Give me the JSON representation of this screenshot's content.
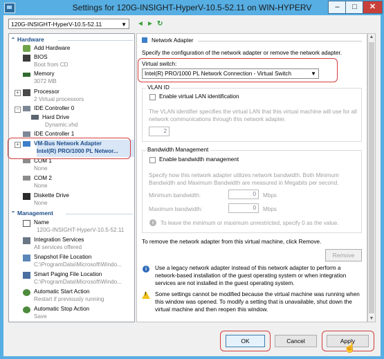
{
  "window": {
    "title": "Settings for 120G-INSIGHT-HyperV-10.5-52.11 on WIN-HYPERV",
    "minimize_glyph": "–",
    "maximize_glyph": "□",
    "close_glyph": "✕"
  },
  "toolbar": {
    "vm_selector_value": "120G-INSIGHT-HyperV-10.5-52.11",
    "back_glyph": "◄",
    "forward_glyph": "►",
    "refresh_glyph": "↻"
  },
  "tree": {
    "hardware_label": "Hardware",
    "management_label": "Management",
    "items": {
      "add_hardware": "Add Hardware",
      "bios": "BIOS",
      "bios_sub": "Boot from CD",
      "memory": "Memory",
      "memory_sub": "3072 MB",
      "processor": "Processor",
      "processor_sub": "2 Virtual processors",
      "ide0": "IDE Controller 0",
      "hard_drive": "Hard Drive",
      "hard_drive_sub": "Dynamic.vhd",
      "ide1": "IDE Controller 1",
      "vmbus": "VM-Bus Network Adapter",
      "vmbus_sub": "Intel(R) PRO/1000 PL Networ...",
      "com1": "COM 1",
      "com1_sub": "None",
      "com2": "COM 2",
      "com2_sub": "None",
      "diskette": "Diskette Drive",
      "diskette_sub": "None",
      "name": "Name",
      "name_sub": "120G-INSIGHT-HyperV-10.5-52.11",
      "integration": "Integration Services",
      "integration_sub": "All services offered",
      "snapshot": "Snapshot File Location",
      "snapshot_sub": "C:\\ProgramData\\Microsoft\\Windo...",
      "paging": "Smart Paging File Location",
      "paging_sub": "C:\\ProgramData\\Microsoft\\Windo...",
      "auto_start": "Automatic Start Action",
      "auto_start_sub": "Restart if previously running",
      "auto_stop": "Automatic Stop Action",
      "auto_stop_sub": "Save"
    }
  },
  "panel": {
    "header": "Network Adapter",
    "description": "Specify the configuration of the network adapter or remove the network adapter.",
    "virtual_switch_label": "Virtual switch:",
    "virtual_switch_value": "Intel(R) PRO/1000 PL Network Connection - Virtual Switch",
    "vlan_group_label": "VLAN ID",
    "vlan_checkbox_label": "Enable virtual LAN identification",
    "vlan_help_1": "The VLAN identifier specifies the virtual LAN that this virtual machine will use for all",
    "vlan_help_2": "network communications through this network adapter.",
    "vlan_value": "2",
    "bw_group_label": "Bandwidth Management",
    "bw_checkbox_label": "Enable bandwidth management",
    "bw_help_1": "Specify how this network adapter utilizes network bandwidth. Both Minimum",
    "bw_help_2": "Bandwidth and Maximum Bandwidth are measured in Megabits per second.",
    "min_bw_label": "Minimum bandwidth:",
    "min_bw_value": "0",
    "max_bw_label": "Maximum bandwidth:",
    "max_bw_value": "0",
    "unit_label": "Mbps",
    "bw_info": "To leave the minimum or maximum unrestricted, specify 0 as the value.",
    "remove_text": "To remove the network adapter from this virtual machine, click Remove.",
    "remove_button": "Remove",
    "legacy_1": "Use a legacy network adapter instead of this network adapter to perform a",
    "legacy_2": "network-based installation of the guest operating system or when integration",
    "legacy_3": "services are not installed in the guest operating system.",
    "warn_1": "Some settings cannot be modified because the virtual machine was running when",
    "warn_2": "this window was opened. To modify a setting that is unavailable, shut down the",
    "warn_3": "virtual machine and then reopen this window."
  },
  "footer": {
    "ok": "OK",
    "cancel": "Cancel",
    "apply": "Apply"
  },
  "colors": {
    "frame": "#56aee3",
    "highlight": "#d33b3b",
    "section_header": "#1f4f8b"
  }
}
